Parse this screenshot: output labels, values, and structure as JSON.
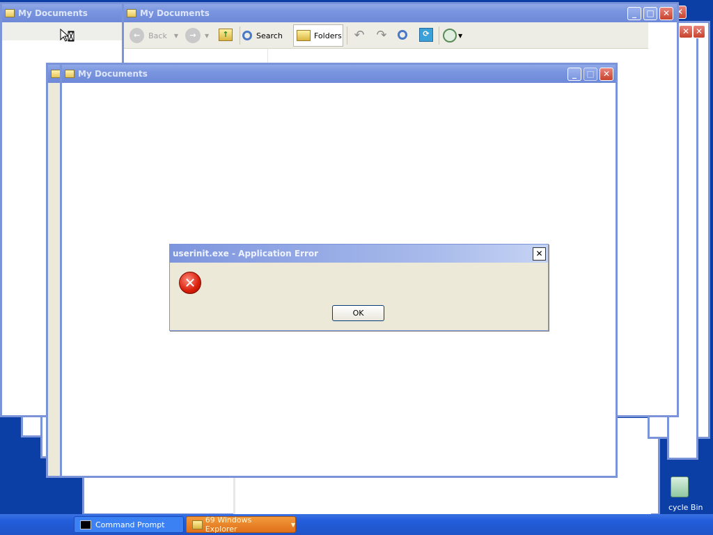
{
  "windows": {
    "title": "My Documents"
  },
  "toolbar": {
    "back_label": "Back",
    "search_label": "Search",
    "folders_label": "Folders"
  },
  "dialog": {
    "title": "userinit.exe - Application Error",
    "ok_label": "OK",
    "error_icon": "error-x-icon"
  },
  "taskbar": {
    "command_prompt_label": "Command Prompt",
    "explorer_group_label": "69 Windows Explorer"
  },
  "desktop": {
    "recycle_bin_label": "cycle Bin"
  },
  "colors": {
    "desktop": "#0b3fa6",
    "titlebar_inactive": "#7a95df",
    "dialog_bg": "#ece9d8",
    "taskbar": "#245edb",
    "explorer_group": "#e8781e"
  }
}
